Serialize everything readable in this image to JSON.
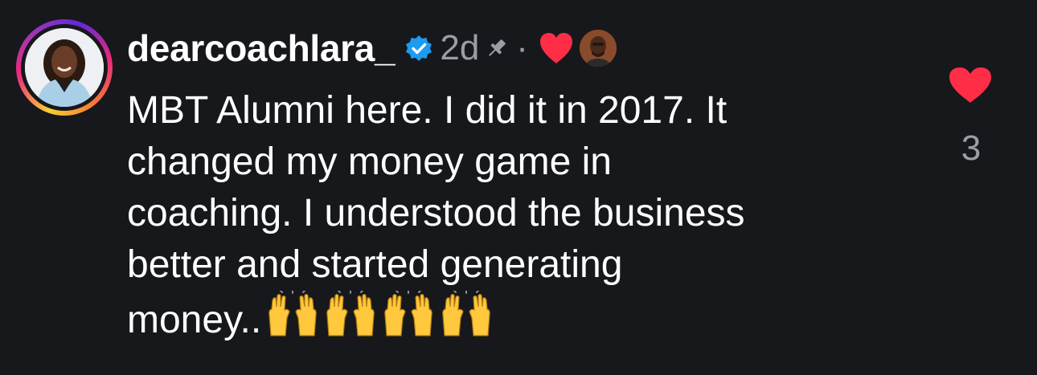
{
  "comment": {
    "username": "dearcoachlara_",
    "verified": true,
    "time": "2d",
    "pinned_icon": "pin-icon",
    "separator": "·",
    "creator_liked": true,
    "lines": [
      "MBT Alumni here. I did it in 2017. It",
      "changed my money game in",
      "coaching. I understood the business",
      "better and started generating",
      "money.."
    ],
    "emoji": "raising-hands-emoji",
    "emoji_count": 4,
    "like_count": "3"
  },
  "colors": {
    "background": "#16181c",
    "text": "#ffffff",
    "muted": "#9a9ea4",
    "heart": "#ff2d46",
    "verified": "#1d9bf0"
  }
}
